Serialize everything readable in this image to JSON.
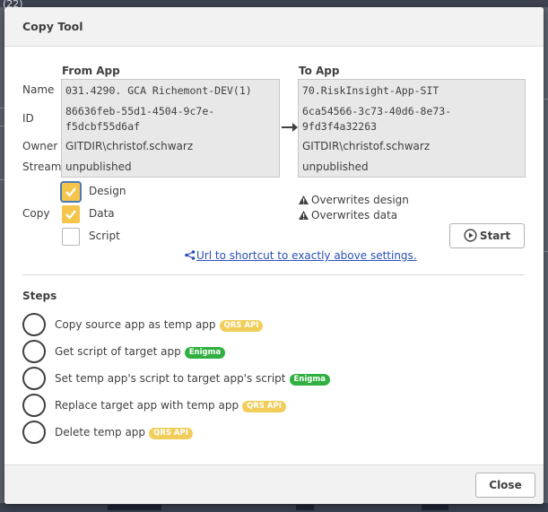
{
  "background": {
    "tag": "(22)"
  },
  "dialog": {
    "title": "Copy Tool",
    "close_label": "Close"
  },
  "columns": {
    "from": "From App",
    "to": "To App"
  },
  "row_labels": {
    "name": "Name",
    "id": "ID",
    "owner": "Owner",
    "stream": "Stream"
  },
  "from_app": {
    "name": "031.4290. GCA Richemont-DEV(1)",
    "id_line1": "86636feb-55d1-4504-9c7e-",
    "id_line2": "f5dcbf55d6af",
    "owner": "GITDIR\\christof.schwarz",
    "stream": "unpublished"
  },
  "to_app": {
    "name": "70.RiskInsight-App-SIT",
    "id_line1": "6ca54566-3c73-40d6-8e73-",
    "id_line2": "9fd3f4a32263",
    "owner": "GITDIR\\christof.schwarz",
    "stream": "unpublished"
  },
  "copy": {
    "label": "Copy",
    "options": [
      {
        "label": "Design",
        "checked": true
      },
      {
        "label": "Data",
        "checked": true
      },
      {
        "label": "Script",
        "checked": false
      }
    ]
  },
  "warnings": [
    "Overwrites design",
    "Overwrites data"
  ],
  "start_label": "Start",
  "shortcut_link": "Url to shortcut to exactly above settings.",
  "steps": {
    "heading": "Steps",
    "items": [
      {
        "text": "Copy source app as temp app",
        "badge": "QRS API"
      },
      {
        "text": "Get script of target app",
        "badge": "Enigma"
      },
      {
        "text": "Set temp app's script to target app's script",
        "badge": "Enigma"
      },
      {
        "text": "Replace target app with temp app",
        "badge": "QRS API"
      },
      {
        "text": "Delete temp app",
        "badge": "QRS API"
      }
    ]
  },
  "colors": {
    "accent": "#f5c44b",
    "qrs_badge": "#f1cd5a",
    "enigma_badge": "#30b040",
    "link": "#2a4fb8"
  },
  "icons": [
    "warning-icon",
    "play-circle-icon",
    "share-icon",
    "arrow-right-icon",
    "check-icon"
  ]
}
